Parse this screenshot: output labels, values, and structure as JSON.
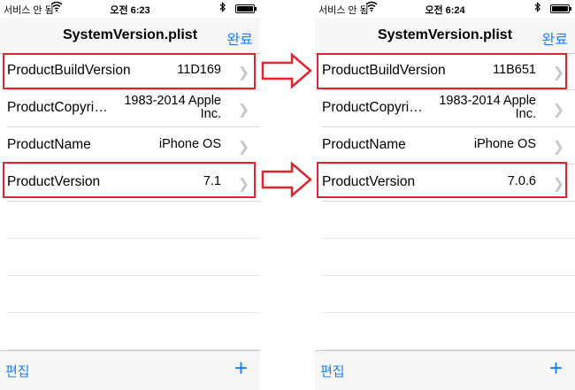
{
  "status": {
    "carrier": "서비스 안 됨"
  },
  "screens": [
    {
      "time": "오전 6:23",
      "nav": {
        "title": "SystemVersion.plist",
        "done": "완료"
      },
      "rows": [
        {
          "key": "ProductBuildVersion",
          "value": "11D169"
        },
        {
          "key": "ProductCopyri…",
          "value": "1983-2014 Apple Inc."
        },
        {
          "key": "ProductName",
          "value": "iPhone OS"
        },
        {
          "key": "ProductVersion",
          "value": "7.1"
        }
      ],
      "toolbar": {
        "edit": "편집",
        "add": "+"
      }
    },
    {
      "time": "오전 6:24",
      "nav": {
        "title": "SystemVersion.plist",
        "done": "완료"
      },
      "rows": [
        {
          "key": "ProductBuildVersion",
          "value": "11B651"
        },
        {
          "key": "ProductCopyri…",
          "value": "1983-2014 Apple Inc."
        },
        {
          "key": "ProductName",
          "value": "iPhone OS"
        },
        {
          "key": "ProductVersion",
          "value": "7.0.6"
        }
      ],
      "toolbar": {
        "edit": "편집",
        "add": "+"
      }
    }
  ],
  "icons": {
    "chevron": "chevron-right-icon",
    "wifi": "wifi-icon",
    "bluetooth": "bluetooth-icon",
    "battery": "battery-icon",
    "arrow": "right-arrow-icon"
  },
  "colors": {
    "accent": "#147efb",
    "highlight": "#e0242f",
    "chevron": "#c7c7cc"
  },
  "battery_level": 1
}
